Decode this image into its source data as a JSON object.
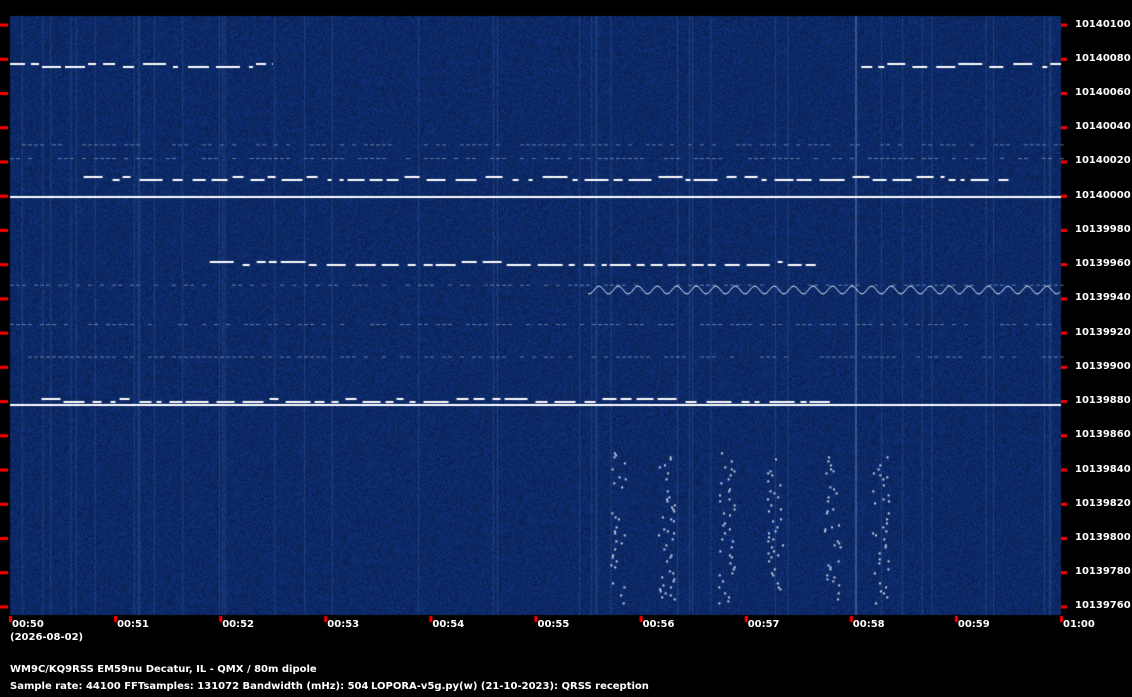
{
  "chart_data": {
    "type": "heatmap",
    "description_of_axes": "",
    "x_ticks": [
      "00:50",
      "00:51",
      "00:52",
      "00:53",
      "00:54",
      "00:55",
      "00:56",
      "00:57",
      "00:58",
      "00:59",
      "01:00"
    ],
    "y_ticks": [
      "10140100",
      "10140080",
      "10140060",
      "10140040",
      "10140020",
      "10140000",
      "10139980",
      "10139960",
      "10139940",
      "10139920",
      "10139900",
      "10139880",
      "10139860",
      "10139840",
      "10139820",
      "10139800",
      "10139780",
      "10139760"
    ],
    "ylim": [
      10139755,
      10140105
    ],
    "background_color": "#0d2e63",
    "trace_color": "#ffffff",
    "tick_color": "#ff0000",
    "signal_traces": [
      {
        "freq": 10140076,
        "x_start": 0.0,
        "x_end": 0.25
      },
      {
        "freq": 10140076,
        "x_start": 0.81,
        "x_end": 1.0
      },
      {
        "freq": 10140010,
        "x_start": 0.07,
        "x_end": 0.95
      },
      {
        "freq": 10140000,
        "x_start": 0.0,
        "x_end": 1.0
      },
      {
        "freq": 10139960,
        "x_start": 0.19,
        "x_end": 0.77
      },
      {
        "freq": 10139945,
        "x_start": 0.55,
        "x_end": 1.0
      },
      {
        "freq": 10139880,
        "x_start": 0.03,
        "x_end": 0.78
      },
      {
        "freq": 10139878,
        "x_start": 0.0,
        "x_end": 1.0
      }
    ]
  },
  "footer": {
    "date": "(2026-08-02)",
    "station": "WM9C/KQ9RSS EM59nu Decatur, IL - QMX / 80m dipole",
    "params": "Sample rate: 44100    FFTsamples: 131072    Bandwidth (mHz): 504",
    "software": "LOPORA-v5g.py(w) (21-10-2023): QRSS reception"
  }
}
